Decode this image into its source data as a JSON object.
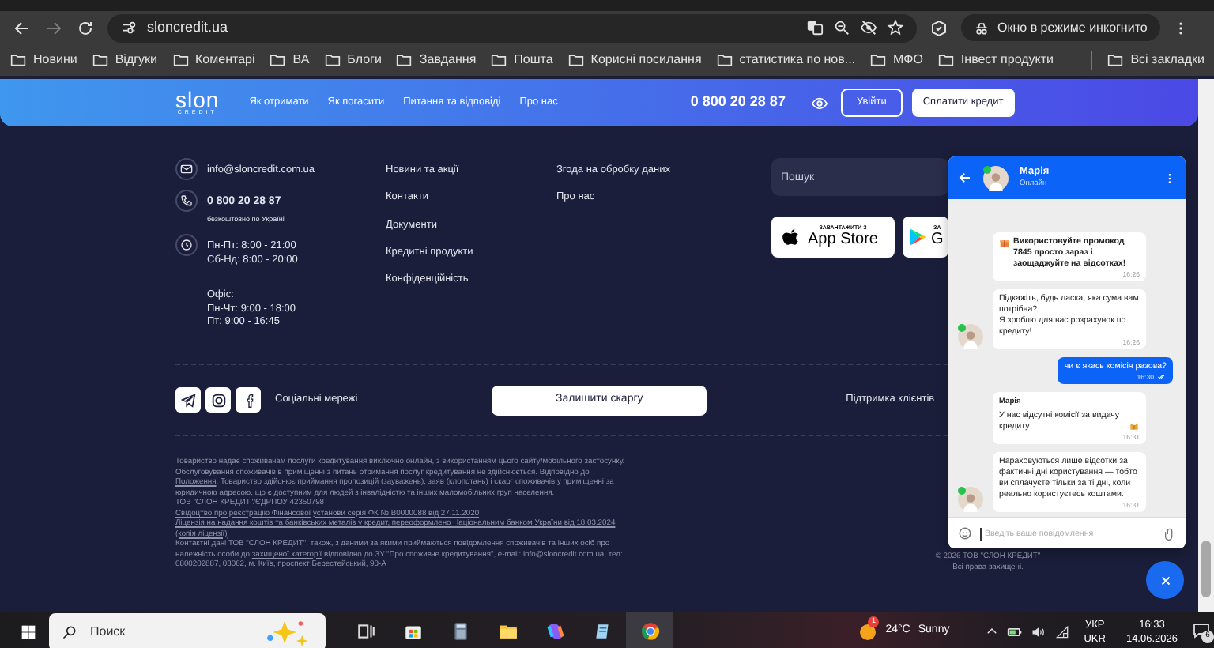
{
  "browser": {
    "back_button": {
      "disabled": false
    },
    "forward_button": {
      "disabled": true
    },
    "url": "sloncredit.ua",
    "bookmarked": false,
    "incognito_label": "Окно в режиме инкогнито",
    "bookmarks": [
      {
        "label": "Новини"
      },
      {
        "label": "Відгуки"
      },
      {
        "label": "Коментарі"
      },
      {
        "label": "ВА"
      },
      {
        "label": "Блоги"
      },
      {
        "label": "Завдання"
      },
      {
        "label": "Пошта"
      },
      {
        "label": "Корисні посилання"
      },
      {
        "label": "статистика по нов..."
      },
      {
        "label": "МФО"
      },
      {
        "label": "Інвест продукти"
      }
    ],
    "all_bookmarks": "Всі закладки"
  },
  "site_header": {
    "logo": "slon",
    "logo_subtitle": "CREDIT",
    "nav": [
      "Як отримати",
      "Як погасити",
      "Питання та відповіді",
      "Про нас"
    ],
    "phone": "0 800 20 28 87",
    "login_button": "Увійти",
    "pay_button": "Сплатити кредит"
  },
  "footer": {
    "email": "info@sloncredit.com.ua",
    "phone": "0 800 20 28 87",
    "phone_note": "безкоштовно по Україні",
    "hours": [
      "Пн-Пт: 8:00 - 21:00",
      "Сб-Нд: 8:00 - 20:00"
    ],
    "office": [
      "Офіс:",
      "Пн-Чт: 9:00 - 18:00",
      "Пт: 9:00 - 16:45"
    ],
    "links_1": [
      "Новини та акції",
      "Контакти",
      "Документи",
      "Кредитні продукти",
      "Конфіденційність"
    ],
    "links_2": [
      "Згода на обробку даних",
      "Про нас"
    ],
    "search": {
      "placeholder": "Пошук"
    },
    "app_store": {
      "small": "ЗАВАНТАЖИТИ З",
      "big": "App Store"
    },
    "google_play": {
      "small": "ЗА",
      "big": "G"
    },
    "social_label": "Соціальні мережі",
    "complaint_button": "Залишити скаргу",
    "support": "Підтримка клієнтів",
    "legal": [
      {
        "parts": [
          {
            "text": "Товариство надає споживачам послуги кредитування виключно онлайн, з використанням цього сайту/мобільного застосунку. Обслуговування споживачів в приміщенні з питань отримання послуг кредитування не здійснюється. Відповідно до ",
            "link": false
          },
          {
            "text": "Положення",
            "link": true
          },
          {
            "text": ", Товариство здійснює приймання пропозицій (зауважень), заяв (клопотань) і скарг споживачів у приміщенні за юридичною адресою, що є доступним для людей з інвалідністю та інших маломобільних груп населення.",
            "link": false
          }
        ]
      },
      {
        "parts": [
          {
            "text": "ТОВ \"СЛОН КРЕДИТ\"/ЄДРПОУ 42350798",
            "link": false
          }
        ]
      },
      {
        "parts": [
          {
            "text": "Свідоцтво про реєстрацію Фінансової установи серія ФК № B0000088 від 27.11.2020",
            "link": true
          }
        ]
      },
      {
        "parts": [
          {
            "text": "Ліцензія на надання коштів та банківських металів у кредит, переоформлено Національним банком України від 18.03.2024 (копія ліцензії)",
            "link": true
          }
        ]
      },
      {
        "parts": [
          {
            "text": "Контактні дані ТОВ \"СЛОН КРЕДИТ\", також, з даними за якими приймаються повідомлення споживачів та інших осіб про належність особи до ",
            "link": false
          },
          {
            "text": "захищеної категорії",
            "link": true
          },
          {
            "text": " відповідно до ЗУ \"Про споживче кредитування\", e-mail: info@sloncredit.com.ua, тел: 0800202887, 03062, м. Київ, проспект Берестейський, 90-А",
            "link": false
          }
        ]
      }
    ],
    "copyright": [
      "© 2026 ТОВ \"СЛОН КРЕДИТ\"",
      "Всі права захищені."
    ]
  },
  "chat": {
    "agent_name": "Марія",
    "agent_status": "Онлайн",
    "online": true,
    "messages": [
      {
        "kind": "incoming",
        "text": "Використовуйте промокод 7845 просто зараз і заощаджуйте на відсотках!",
        "time": "16:26",
        "bold": true,
        "leading_icon": true,
        "avatar": false
      },
      {
        "kind": "incoming",
        "text": "Підкажіть, будь ласка, яка сума вам потрібна?\nЯ зроблю для вас розрахунок по кредиту!",
        "time": "16:26",
        "avatar": true
      },
      {
        "kind": "outgoing",
        "text": "чи є якась комісія разова?",
        "time": "16:30",
        "read": true
      },
      {
        "kind": "incoming",
        "sender": "Марія",
        "text": "У нас відсутні комісії за видачу кредиту",
        "time": "16:31",
        "trailing_icon": true,
        "avatar": false
      },
      {
        "kind": "incoming",
        "text": "Нараховуються лише відсотки за фактичні дні користування — тобто ви сплачуєте тільки за ті дні, коли реально користуєтесь коштами.",
        "time": "16:31",
        "avatar": true
      }
    ],
    "input": {
      "placeholder": "Введіть ваше повідомлення"
    }
  },
  "taskbar": {
    "search": {
      "placeholder": "Поиск"
    },
    "apps": [
      {
        "kind": "taskview",
        "active": false
      },
      {
        "kind": "store",
        "active": false
      },
      {
        "kind": "calculator",
        "active": false
      },
      {
        "kind": "explorer",
        "active": false
      },
      {
        "kind": "copilot",
        "active": false
      },
      {
        "kind": "notepad",
        "active": false
      },
      {
        "kind": "chrome",
        "active": true
      }
    ],
    "weather_badge": "1",
    "temperature": "24°C",
    "weather": "Sunny",
    "language": [
      "УКР",
      "UKR"
    ],
    "time": "16:33",
    "date": "14.06.2026",
    "notifications": "6"
  }
}
